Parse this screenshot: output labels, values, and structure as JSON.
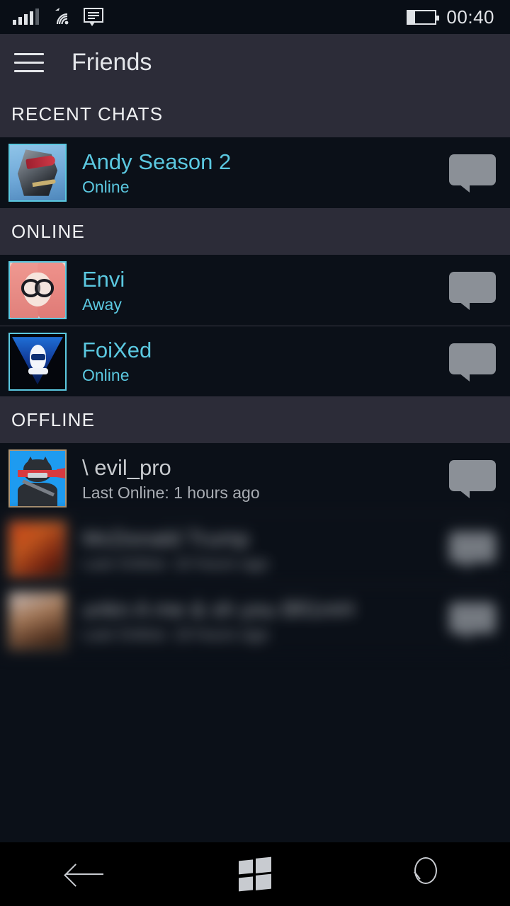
{
  "statusbar": {
    "signal_icon": "cellular-signal-icon",
    "wifi_icon": "wifi-icon",
    "sms_icon": "sms-message-icon",
    "battery_icon": "battery-icon",
    "battery_level_pct": 25,
    "time": "00:40"
  },
  "titlebar": {
    "menu_icon": "hamburger-menu-icon",
    "title": "Friends"
  },
  "colors": {
    "accent_cyan": "#5BC8E0",
    "page_bg": "#0B1018",
    "header_bg": "#2C2C38",
    "offline_text": "#C7CACE",
    "bubble_gray": "#8B9097",
    "online_border": "#5BC8E0",
    "offline_border": "#B09776"
  },
  "sections": [
    {
      "header": "RECENT CHATS",
      "rows": [
        {
          "name": "Andy Season 2",
          "status": "Online",
          "avatar": "mecha-robot-avatar",
          "art_class": "art-mecha",
          "offline": false,
          "blurred": false
        }
      ]
    },
    {
      "header": "ONLINE",
      "rows": [
        {
          "name": "Envi",
          "status": "Away",
          "avatar": "anime-girl-glasses-avatar",
          "art_class": "art-envi",
          "offline": false,
          "blurred": false
        },
        {
          "name": "FoiXed",
          "status": "Online",
          "avatar": "blue-triangle-logo-avatar",
          "art_class": "art-foixed",
          "offline": false,
          "blurred": false
        }
      ]
    },
    {
      "header": "OFFLINE",
      "rows": [
        {
          "name": "\\ evil_pro",
          "status": "Last Online: 1 hours ago",
          "avatar": "ninja-cat-avatar",
          "art_class": "art-ninja",
          "offline": true,
          "blurred": false
        },
        {
          "name": "McDonald Trump",
          "status": "Last Online: 10 hours ago",
          "avatar": "orange-gradient-avatar",
          "art_class": "art-blur1",
          "offline": true,
          "blurred": true
        },
        {
          "name": "unkn A me & sh you Bfi1mH",
          "status": "Last Online: 19 hours ago",
          "avatar": "portrait-photo-avatar",
          "art_class": "art-blur2",
          "offline": true,
          "blurred": true
        }
      ]
    }
  ],
  "row_action": {
    "chat_icon": "chat-bubble-icon"
  },
  "navbar": {
    "back_label": "back-arrow-icon",
    "start_label": "windows-start-icon",
    "search_label": "search-icon"
  }
}
